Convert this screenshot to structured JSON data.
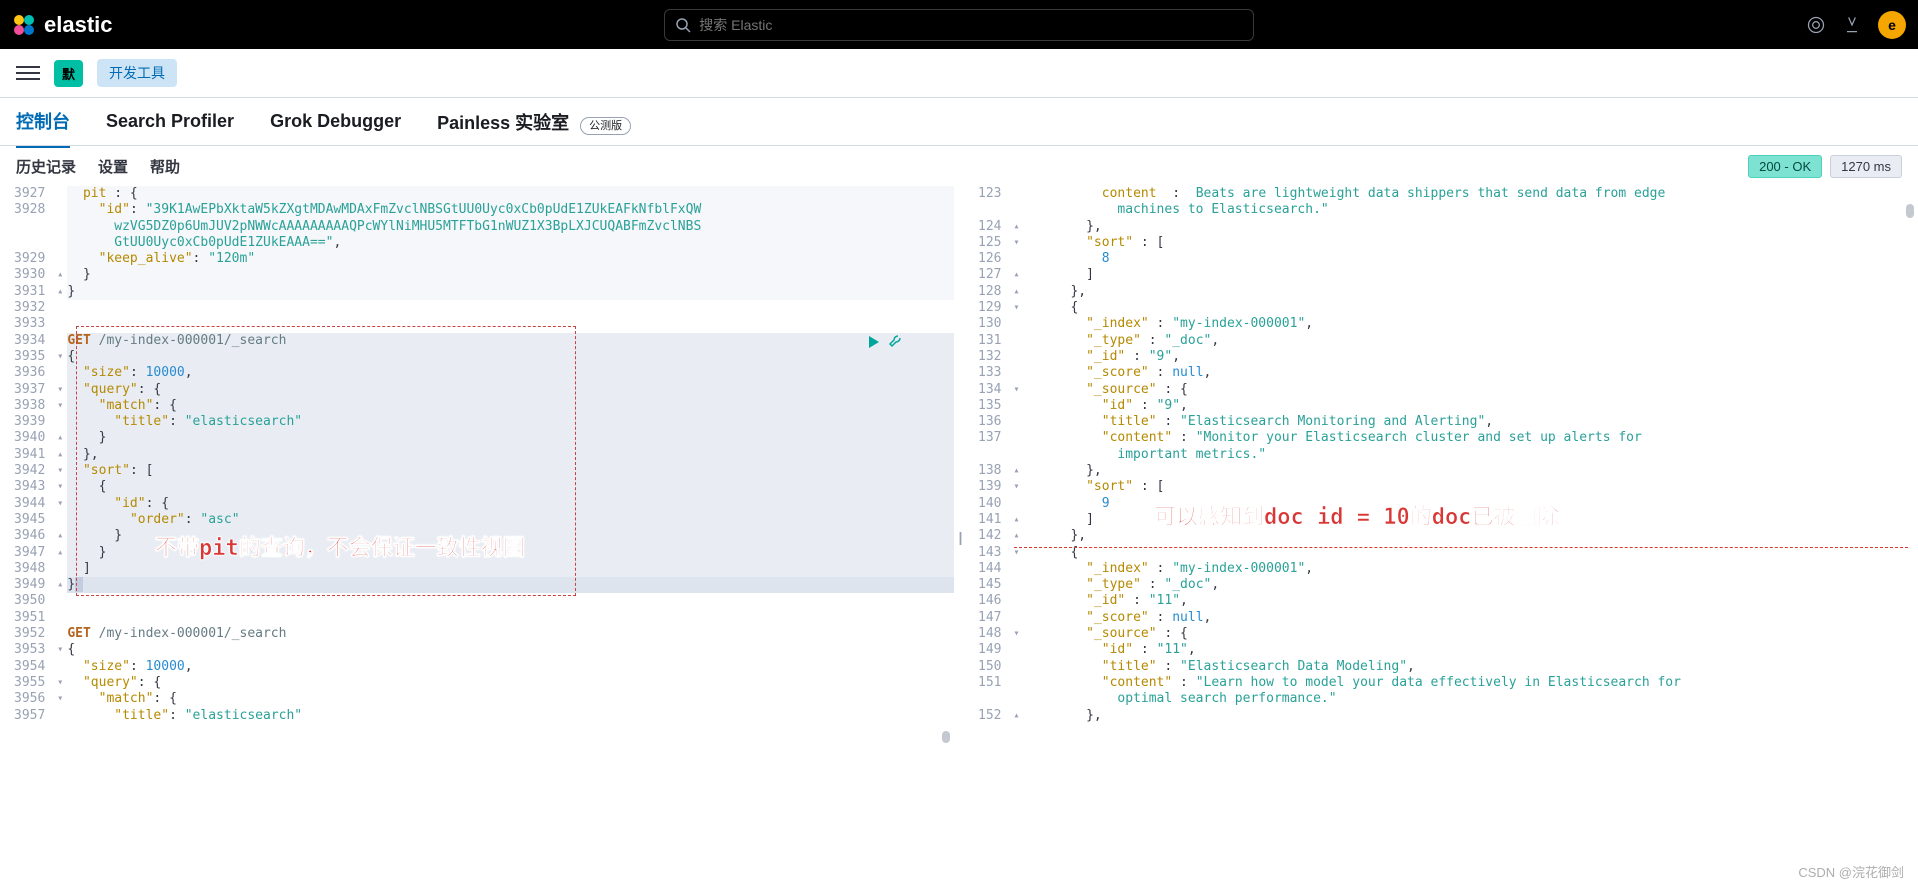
{
  "header": {
    "brand": "elastic",
    "search_placeholder": "搜索 Elastic",
    "avatar_letter": "e"
  },
  "subheader": {
    "space_badge": "默",
    "tool_label": "开发工具"
  },
  "tabs": {
    "console": "控制台",
    "profiler": "Search Profiler",
    "grok": "Grok Debugger",
    "painless": "Painless 实验室",
    "beta": "公测版"
  },
  "toolbar": {
    "history": "历史记录",
    "settings": "设置",
    "help": "帮助",
    "status": "200 - OK",
    "timing": "1270 ms"
  },
  "left_lines": {
    "start": 3927,
    "rows": [
      {
        "n": "3927",
        "f": "",
        "cls": "hl-grey",
        "html": "  <span class='kw-key'>pit</span> : {"
      },
      {
        "n": "3928",
        "f": "",
        "cls": "hl-grey",
        "html": "    <span class='kw-key'>\"id\"</span>: <span class='kw-str'>\"39K1AwEPbXktaW5kZXgtMDAwMDAxFmZvclNBSGtUU0Uyc0xCb0pUdE1ZUkEAFkNfblFxQW</span>"
      },
      {
        "n": "",
        "f": "",
        "cls": "hl-grey",
        "html": "      <span class='kw-str'>wzVG5DZ0p6UmJUV2pNWWcAAAAAAAAAQPcWYlNiMHU5MTFTbG1nWUZ1X3BpLXJCUQABFmZvclNBS</span>"
      },
      {
        "n": "",
        "f": "",
        "cls": "hl-grey",
        "html": "      <span class='kw-str'>GtUU0Uyc0xCb0pUdE1ZUkEAAA==\"</span>,"
      },
      {
        "n": "3929",
        "f": "",
        "cls": "hl-grey",
        "html": "    <span class='kw-key'>\"keep_alive\"</span>: <span class='kw-str'>\"120m\"</span>"
      },
      {
        "n": "3930",
        "f": "▴",
        "cls": "hl-grey",
        "html": "  }"
      },
      {
        "n": "3931",
        "f": "▴",
        "cls": "hl-grey",
        "html": "}"
      },
      {
        "n": "3932",
        "f": "",
        "cls": "",
        "html": ""
      },
      {
        "n": "3933",
        "f": "",
        "cls": "",
        "html": ""
      },
      {
        "n": "3934",
        "f": "",
        "cls": "hl-sel",
        "html": "<span class='kw-method'>GET</span> <span class='kw-url'>/my-index-000001/_search</span>"
      },
      {
        "n": "3935",
        "f": "▾",
        "cls": "hl-sel",
        "html": "{"
      },
      {
        "n": "3936",
        "f": "",
        "cls": "hl-sel",
        "html": "  <span class='kw-key'>\"size\"</span>: <span class='kw-num'>10000</span>,"
      },
      {
        "n": "3937",
        "f": "▾",
        "cls": "hl-sel",
        "html": "  <span class='kw-key'>\"query\"</span>: {"
      },
      {
        "n": "3938",
        "f": "▾",
        "cls": "hl-sel",
        "html": "    <span class='kw-key'>\"match\"</span>: {"
      },
      {
        "n": "3939",
        "f": "",
        "cls": "hl-sel",
        "html": "      <span class='kw-key'>\"title\"</span>: <span class='kw-str'>\"elasticsearch\"</span>"
      },
      {
        "n": "3940",
        "f": "▴",
        "cls": "hl-sel",
        "html": "    }"
      },
      {
        "n": "3941",
        "f": "▴",
        "cls": "hl-sel",
        "html": "  },"
      },
      {
        "n": "3942",
        "f": "▾",
        "cls": "hl-sel",
        "html": "  <span class='kw-key'>\"sort\"</span>: ["
      },
      {
        "n": "3943",
        "f": "▾",
        "cls": "hl-sel",
        "html": "    {"
      },
      {
        "n": "3944",
        "f": "▾",
        "cls": "hl-sel",
        "html": "      <span class='kw-key'>\"id\"</span>: {"
      },
      {
        "n": "3945",
        "f": "",
        "cls": "hl-sel",
        "html": "        <span class='kw-key'>\"order\"</span>: <span class='kw-str'>\"asc\"</span>"
      },
      {
        "n": "3946",
        "f": "▴",
        "cls": "hl-sel",
        "html": "      }"
      },
      {
        "n": "3947",
        "f": "▴",
        "cls": "hl-sel",
        "html": "    }"
      },
      {
        "n": "3948",
        "f": "",
        "cls": "hl-sel",
        "html": "  ]"
      },
      {
        "n": "3949",
        "f": "▴",
        "cls": "hl-sel-dark",
        "html": "}<span style='background:#c4cde0'>&nbsp;</span>"
      },
      {
        "n": "3950",
        "f": "",
        "cls": "",
        "html": ""
      },
      {
        "n": "3951",
        "f": "",
        "cls": "",
        "html": ""
      },
      {
        "n": "3952",
        "f": "",
        "cls": "",
        "html": "<span class='kw-method'>GET</span> <span class='kw-url'>/my-index-000001/_search</span>"
      },
      {
        "n": "3953",
        "f": "▾",
        "cls": "",
        "html": "{"
      },
      {
        "n": "3954",
        "f": "",
        "cls": "",
        "html": "  <span class='kw-key'>\"size\"</span>: <span class='kw-num'>10000</span>,"
      },
      {
        "n": "3955",
        "f": "▾",
        "cls": "",
        "html": "  <span class='kw-key'>\"query\"</span>: {"
      },
      {
        "n": "3956",
        "f": "▾",
        "cls": "",
        "html": "    <span class='kw-key'>\"match\"</span>: {"
      },
      {
        "n": "3957",
        "f": "",
        "cls": "",
        "html": "      <span class='kw-key'>\"title\"</span>: <span class='kw-str'>\"elasticsearch\"</span>"
      }
    ]
  },
  "right_lines": {
    "rows": [
      {
        "n": "123",
        "f": "",
        "html": "          <span class='kw-key'>content</span>  :  <span class='kw-str'>Beats are lightweight data shippers that send data from edge</span>"
      },
      {
        "n": "",
        "f": "",
        "html": "            <span class='kw-str'>machines to Elasticsearch.\"</span>"
      },
      {
        "n": "124",
        "f": "▴",
        "html": "        },"
      },
      {
        "n": "125",
        "f": "▾",
        "html": "        <span class='kw-key'>\"sort\"</span> : ["
      },
      {
        "n": "126",
        "f": "",
        "html": "          <span class='kw-num'>8</span>"
      },
      {
        "n": "127",
        "f": "▴",
        "html": "        ]"
      },
      {
        "n": "128",
        "f": "▴",
        "html": "      },"
      },
      {
        "n": "129",
        "f": "▾",
        "html": "      {"
      },
      {
        "n": "130",
        "f": "",
        "html": "        <span class='kw-key'>\"_index\"</span> : <span class='kw-str'>\"my-index-000001\"</span>,"
      },
      {
        "n": "131",
        "f": "",
        "html": "        <span class='kw-key'>\"_type\"</span> : <span class='kw-str'>\"_doc\"</span>,"
      },
      {
        "n": "132",
        "f": "",
        "html": "        <span class='kw-key'>\"_id\"</span> : <span class='kw-str'>\"9\"</span>,"
      },
      {
        "n": "133",
        "f": "",
        "html": "        <span class='kw-key'>\"_score\"</span> : <span class='kw-num'>null</span>,"
      },
      {
        "n": "134",
        "f": "▾",
        "html": "        <span class='kw-key'>\"_source\"</span> : {"
      },
      {
        "n": "135",
        "f": "",
        "html": "          <span class='kw-key'>\"id\"</span> : <span class='kw-str'>\"9\"</span>,"
      },
      {
        "n": "136",
        "f": "",
        "html": "          <span class='kw-key'>\"title\"</span> : <span class='kw-str'>\"Elasticsearch Monitoring and Alerting\"</span>,"
      },
      {
        "n": "137",
        "f": "",
        "html": "          <span class='kw-key'>\"content\"</span> : <span class='kw-str'>\"Monitor your Elasticsearch cluster and set up alerts for</span>"
      },
      {
        "n": "",
        "f": "",
        "html": "            <span class='kw-str'>important metrics.\"</span>"
      },
      {
        "n": "138",
        "f": "▴",
        "html": "        },"
      },
      {
        "n": "139",
        "f": "▾",
        "html": "        <span class='kw-key'>\"sort\"</span> : ["
      },
      {
        "n": "140",
        "f": "",
        "html": "          <span class='kw-num'>9</span>"
      },
      {
        "n": "141",
        "f": "▴",
        "html": "        ]"
      },
      {
        "n": "142",
        "f": "▴",
        "html": "      },"
      },
      {
        "n": "143",
        "f": "▾",
        "html": "      {"
      },
      {
        "n": "144",
        "f": "",
        "html": "        <span class='kw-key'>\"_index\"</span> : <span class='kw-str'>\"my-index-000001\"</span>,"
      },
      {
        "n": "145",
        "f": "",
        "html": "        <span class='kw-key'>\"_type\"</span> : <span class='kw-str'>\"_doc\"</span>,"
      },
      {
        "n": "146",
        "f": "",
        "html": "        <span class='kw-key'>\"_id\"</span> : <span class='kw-str'>\"11\"</span>,"
      },
      {
        "n": "147",
        "f": "",
        "html": "        <span class='kw-key'>\"_score\"</span> : <span class='kw-num'>null</span>,"
      },
      {
        "n": "148",
        "f": "▾",
        "html": "        <span class='kw-key'>\"_source\"</span> : {"
      },
      {
        "n": "149",
        "f": "",
        "html": "          <span class='kw-key'>\"id\"</span> : <span class='kw-str'>\"11\"</span>,"
      },
      {
        "n": "150",
        "f": "",
        "html": "          <span class='kw-key'>\"title\"</span> : <span class='kw-str'>\"Elasticsearch Data Modeling\"</span>,"
      },
      {
        "n": "151",
        "f": "",
        "html": "          <span class='kw-key'>\"content\"</span> : <span class='kw-str'>\"Learn how to model your data effectively in Elasticsearch for</span>"
      },
      {
        "n": "",
        "f": "",
        "html": "            <span class='kw-str'>optimal search performance.\"</span>"
      },
      {
        "n": "152",
        "f": "▴",
        "html": "        },"
      }
    ]
  },
  "annotations": {
    "left_text": "不带pit的查询，不会保证一致性视图",
    "right_text": "可以感知到doc id = 10的doc已被删除"
  },
  "watermark": "CSDN @浣花御剑"
}
